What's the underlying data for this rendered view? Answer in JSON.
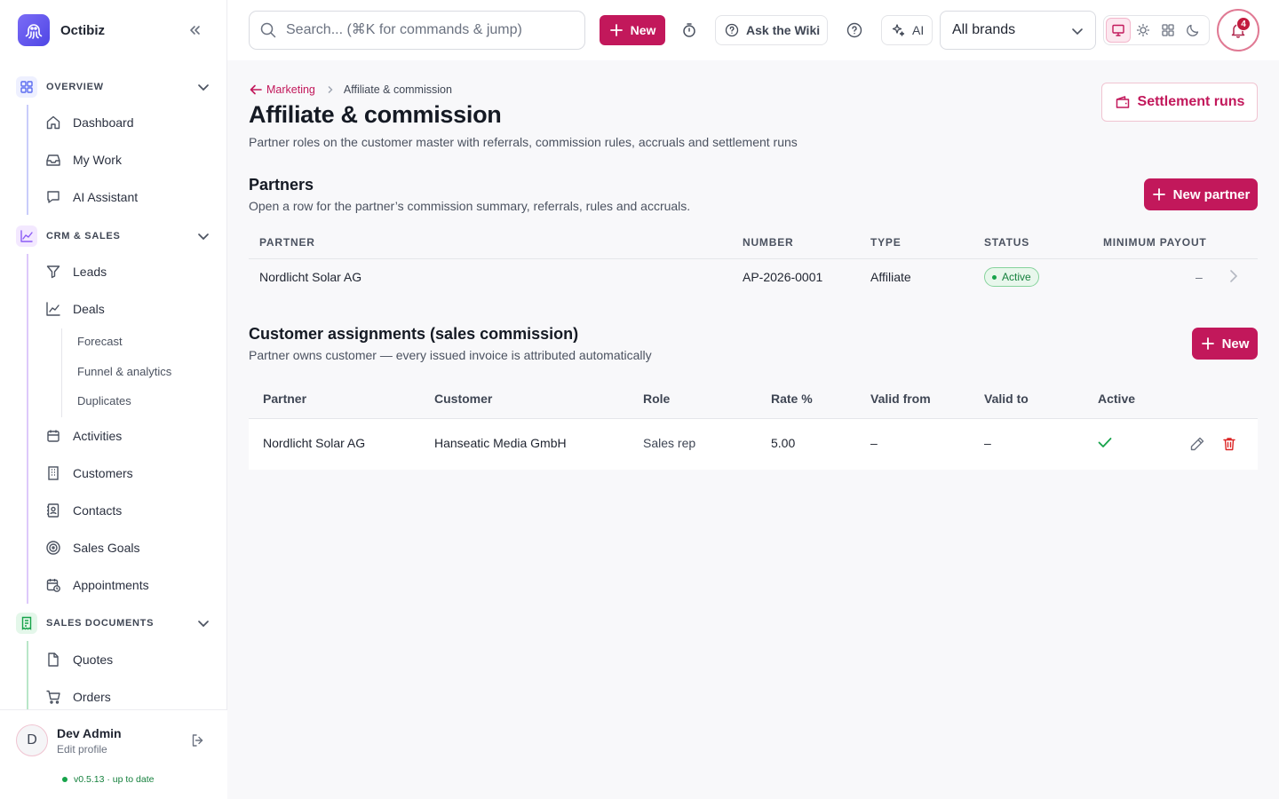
{
  "app": {
    "name": "Octibiz"
  },
  "sidebar": {
    "sections": [
      {
        "label": "OVERVIEW",
        "items": [
          "Dashboard",
          "My Work",
          "AI Assistant"
        ]
      },
      {
        "label": "CRM & SALES",
        "items": [
          "Leads",
          "Deals",
          "Activities",
          "Customers",
          "Contacts",
          "Sales Goals",
          "Appointments"
        ],
        "deal_subitems": [
          "Forecast",
          "Funnel & analytics",
          "Duplicates"
        ]
      },
      {
        "label": "SALES DOCUMENTS",
        "items": [
          "Quotes",
          "Orders"
        ]
      }
    ],
    "user": {
      "initial": "D",
      "name": "Dev Admin",
      "edit_label": "Edit profile"
    },
    "version": {
      "text": "v0.5.13 · up to date"
    }
  },
  "topbar": {
    "search_placeholder": "Search... (⌘K for commands & jump)",
    "new_label": "New",
    "wiki_label": "Ask the Wiki",
    "ai_label": "AI",
    "brand_select": "All brands",
    "notifications_count": "4"
  },
  "page": {
    "breadcrumb_parent": "Marketing",
    "breadcrumb_current": "Affiliate & commission",
    "title": "Affiliate & commission",
    "subtitle": "Partner roles on the customer master with referrals, commission rules, accruals and settlement runs",
    "settlement_runs_label": "Settlement runs"
  },
  "partners": {
    "title": "Partners",
    "subtitle": "Open a row for the partner’s commission summary, referrals, rules and accruals.",
    "new_button": "New partner",
    "columns": [
      "PARTNER",
      "NUMBER",
      "TYPE",
      "STATUS",
      "MINIMUM PAYOUT"
    ],
    "rows": [
      {
        "partner": "Nordlicht Solar AG",
        "number": "AP-2026-0001",
        "type": "Affiliate",
        "status": "Active",
        "minimum_payout": "–"
      }
    ]
  },
  "assignments": {
    "title": "Customer assignments (sales commission)",
    "subtitle": "Partner owns customer — every issued invoice is attributed automatically",
    "new_button": "New",
    "columns": [
      "Partner",
      "Customer",
      "Role",
      "Rate %",
      "Valid from",
      "Valid to",
      "Active"
    ],
    "rows": [
      {
        "partner": "Nordlicht Solar AG",
        "customer": "Hanseatic Media GmbH",
        "role": "Sales rep",
        "rate": "5.00",
        "valid_from": "–",
        "valid_to": "–",
        "active": true
      }
    ]
  },
  "colors": {
    "accent": "#c2185b",
    "success": "#16a34a"
  }
}
